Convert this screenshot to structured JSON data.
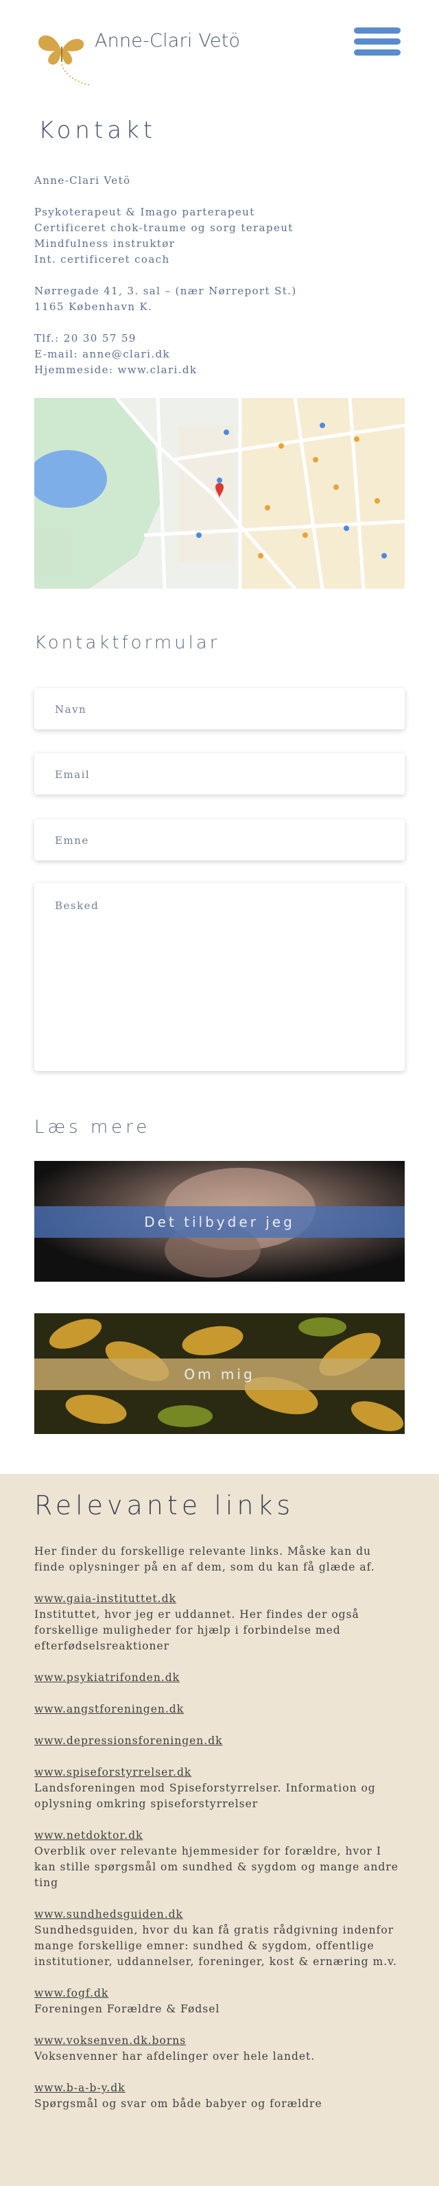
{
  "header": {
    "brand": "Anne-Clari Vetö",
    "logo_icon": "butterfly-icon",
    "menu_icon": "hamburger-menu-icon",
    "accent": "#5a8bcc",
    "logo_color": "#d6a547"
  },
  "kontakt": {
    "title": "Kontakt",
    "name": "Anne-Clari Vetö",
    "titles": [
      "Psykoterapeut & Imago parterapeut",
      "Certificeret chok-traume og sorg terapeut",
      "Mindfulness instruktør",
      "Int. certificeret coach"
    ],
    "address": [
      "Nørregade 41, 3. sal – (nær Nørreport St.)",
      "1165 København K."
    ],
    "phone": "Tlf.: 20 30 57 59",
    "email": "E-mail: anne@clari.dk",
    "website": "Hjemmeside: www.clari.dk"
  },
  "form": {
    "title": "Kontaktformular",
    "name_placeholder": "Navn",
    "email_placeholder": "Email",
    "subject_placeholder": "Emne",
    "message_placeholder": "Besked"
  },
  "laes_mere": {
    "title": "Læs mere",
    "tiles": [
      {
        "label": "Det tilbyder jeg",
        "band_color": "#4a72b8"
      },
      {
        "label": "Om mig",
        "band_color": "#c8a96a"
      }
    ]
  },
  "links": {
    "title": "Relevante links",
    "intro": "Her finder du forskellige relevante links. Måske kan du finde oplysninger på en af dem, som du kan få glæde af.",
    "items": [
      {
        "url": "www.gaia-instituttet.dk",
        "desc": "Instituttet, hvor jeg er uddannet. Her findes der også forskellige muligheder for hjælp i forbindelse med efterfødselsreaktioner"
      },
      {
        "url": "www.psykiatrifonden.dk",
        "desc": ""
      },
      {
        "url": "www.angstforeningen.dk",
        "desc": ""
      },
      {
        "url": "www.depressionsforeningen.dk",
        "desc": ""
      },
      {
        "url": "www.spiseforstyrrelser.dk",
        "desc": "Landsforeningen mod Spiseforstyrrelser. Information og oplysning omkring spiseforstyrrelser"
      },
      {
        "url": "www.netdoktor.dk",
        "desc": "Overblik over relevante hjemmesider for forældre, hvor I kan stille spørgsmål om sundhed & sygdom og mange andre ting"
      },
      {
        "url": "www.sundhedsguiden.dk",
        "desc": "Sundhedsguiden, hvor du kan få gratis rådgivning indenfor mange forskellige emner: sundhed & sygdom, offentlige institutioner, uddannelser, foreninger, kost & ernæring m.v."
      },
      {
        "url": "www.fogf.dk",
        "desc": "Foreningen Forældre & Fødsel"
      },
      {
        "url": "www.voksenven.dk.borns",
        "desc": "Voksenvenner har afdelinger over hele landet."
      },
      {
        "url": "www.b-a-b-y.dk",
        "desc": "Spørgsmål og svar om både babyer og forældre"
      }
    ]
  }
}
